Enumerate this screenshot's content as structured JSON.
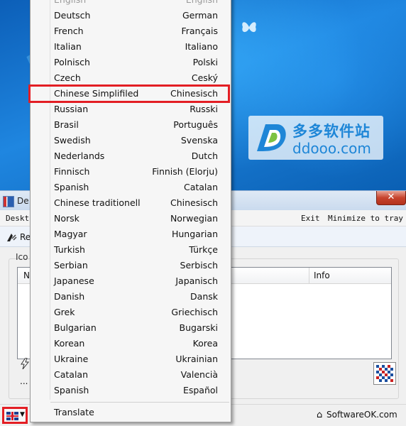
{
  "desktop": {
    "site_logo": {
      "cn": "多多软件站",
      "en": "ddooo.com"
    }
  },
  "window": {
    "title": "De",
    "close_label": "✕",
    "menu": {
      "left": "Deskt",
      "exit": "Exit",
      "minimize": "Minimize to tray"
    },
    "toolbar_label": "Re",
    "group_label": "Ico",
    "listview": {
      "col_name": "N",
      "col_info": "Info"
    },
    "ellipsis": "...",
    "footer_brand": "SoftwareOK.com"
  },
  "language_menu": {
    "items": [
      {
        "left": "English",
        "right": "English",
        "dim": true
      },
      {
        "left": "Deutsch",
        "right": "German"
      },
      {
        "left": "French",
        "right": "Français"
      },
      {
        "left": "Italian",
        "right": "Italiano"
      },
      {
        "left": "Polnisch",
        "right": "Polski"
      },
      {
        "left": "Czech",
        "right": "Ceský"
      },
      {
        "left": "Chinese Simplifiled",
        "right": "Chinesisch",
        "highlighted": true
      },
      {
        "left": "Russian",
        "right": "Russki"
      },
      {
        "left": "Brasil",
        "right": "Português"
      },
      {
        "left": "Swedish",
        "right": "Svenska"
      },
      {
        "left": "Nederlands",
        "right": "Dutch"
      },
      {
        "left": "Finnisch",
        "right": "Finnish (Elorju)"
      },
      {
        "left": "Spanish",
        "right": "Catalan"
      },
      {
        "left": "Chinese traditionell",
        "right": "Chinesisch"
      },
      {
        "left": "Norsk",
        "right": "Norwegian"
      },
      {
        "left": "Magyar",
        "right": "Hungarian"
      },
      {
        "left": "Turkish",
        "right": "Türkçe"
      },
      {
        "left": "Serbian",
        "right": "Serbisch"
      },
      {
        "left": "Japanese",
        "right": "Japanisch"
      },
      {
        "left": "Danish",
        "right": "Dansk"
      },
      {
        "left": "Grek",
        "right": "Griechisch"
      },
      {
        "left": "Bulgarian",
        "right": "Bugarski"
      },
      {
        "left": "Korean",
        "right": "Korea"
      },
      {
        "left": "Ukraine",
        "right": "Ukrainian"
      },
      {
        "left": "Catalan",
        "right": "Valencià"
      },
      {
        "left": "Spanish",
        "right": "Español"
      }
    ],
    "translate_label": "Translate"
  },
  "colors": {
    "highlight_border": "#e31e24",
    "menu_bg": "#f6f6f6"
  }
}
